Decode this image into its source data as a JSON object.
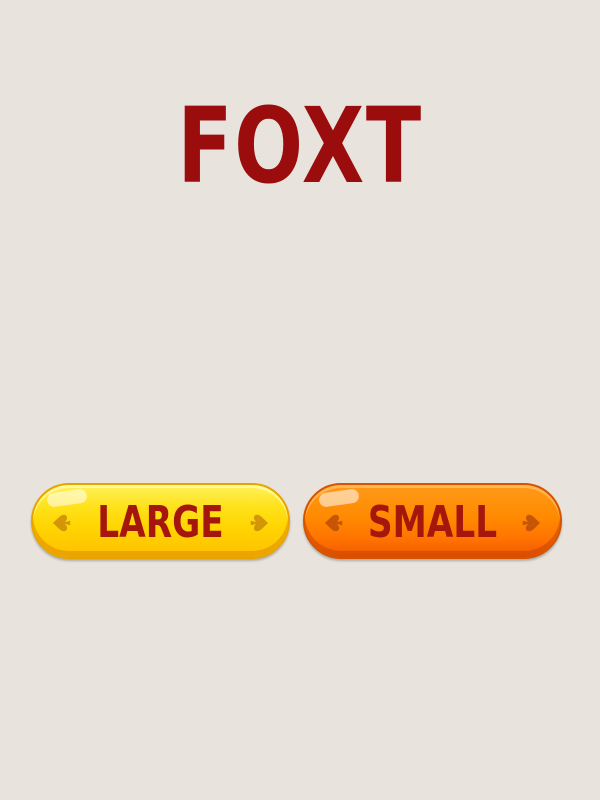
{
  "title": "FOXT",
  "buttons": {
    "large_label": "LARGE",
    "small_label": "SMALL"
  },
  "icons": {
    "decor": "spade-icon"
  },
  "colors": {
    "background": "#e8e4dd",
    "title": "#9b0d0d",
    "label": "#a5160c",
    "large_button": "#ffd400",
    "small_button": "#ff8a00"
  }
}
